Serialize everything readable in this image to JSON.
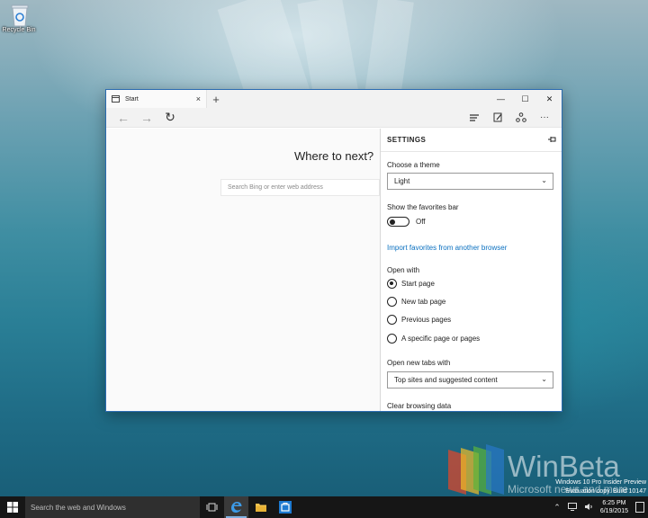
{
  "desktop": {
    "recycle_bin_label": "Recycle Bin"
  },
  "browser": {
    "tab_title": "Start",
    "tab_close": "×",
    "new_tab": "+",
    "window_buttons": {
      "minimize": "—",
      "maximize": "☐",
      "close": "✕"
    },
    "nav": {
      "back": "←",
      "forward": "→",
      "refresh": "↻",
      "more": "···"
    },
    "start_page": {
      "heading": "Where to next?",
      "search_placeholder": "Search Bing or enter web address"
    }
  },
  "settings": {
    "title": "SETTINGS",
    "theme_label": "Choose a theme",
    "theme_value": "Light",
    "favorites_bar_label": "Show the favorites bar",
    "favorites_bar_state": "Off",
    "import_link": "Import favorites from another browser",
    "open_with_label": "Open with",
    "open_with_options": [
      "Start page",
      "New tab page",
      "Previous pages",
      "A specific page or pages"
    ],
    "open_with_selected": "Start page",
    "new_tabs_label": "Open new tabs with",
    "new_tabs_value": "Top sites and suggested content",
    "clear_label": "Clear browsing data"
  },
  "watermark": {
    "brand": "WinBeta",
    "tagline": "Microsoft news and more",
    "build_line1": "Windows 10 Pro Insider Preview",
    "build_line2": "Evaluation copy. Build 10147"
  },
  "taskbar": {
    "search_placeholder": "Search the web and Windows",
    "time": "6:25 PM",
    "date": "6/19/2015"
  },
  "colors": {
    "accent": "#0a70c0",
    "taskbar": "#161616",
    "window_border": "#2b6bb0"
  }
}
